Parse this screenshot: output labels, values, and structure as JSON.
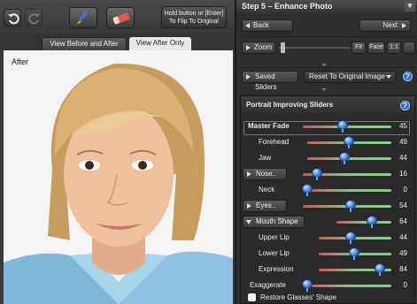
{
  "toolbar": {
    "undo_icon": "undo-icon",
    "redo_icon": "redo-icon",
    "brush_icon": "paintbrush-icon",
    "eraser_icon": "eraser-icon",
    "hint_line1": "Hold button or [Enter]",
    "hint_line2": "To Flip To Original"
  },
  "tabs": {
    "before_after": "View Before and After",
    "after_only": "View After Only"
  },
  "photo": {
    "label": "After"
  },
  "panel": {
    "title": "Step 5 – Enhance Photo",
    "back": "Back",
    "next": "Next",
    "zoom": "Zoom",
    "zoom_level": 0.02,
    "fit": "Fit",
    "face": "Face",
    "one_to_one": "1:1",
    "saved_sliders": "Saved Sliders",
    "preset_value": "Reset To Original Image",
    "help": "?"
  },
  "sliders": {
    "title": "Portrait Improving Sliders",
    "rows": [
      {
        "label": "Master Fade",
        "value": "45",
        "v": 45
      },
      {
        "label": "Forehead",
        "value": "49",
        "v": 49
      },
      {
        "label": "Jaw",
        "value": "44",
        "v": 44
      },
      {
        "label": "Nose..",
        "value": "16",
        "v": 16
      },
      {
        "label": "Neck",
        "value": "0",
        "v": 0
      },
      {
        "label": "Eyes..",
        "value": "54",
        "v": 54
      },
      {
        "label": "Mouth Shape",
        "value": "64",
        "v": 64
      },
      {
        "label": "Upper Lip",
        "value": "44",
        "v": 44
      },
      {
        "label": "Lower Lip",
        "value": "49",
        "v": 49
      },
      {
        "label": "Expression",
        "value": "84",
        "v": 84
      },
      {
        "label": "Exaggerate",
        "value": "0",
        "v": 0
      }
    ],
    "restore_glasses": "Restore Glasses' Shape"
  },
  "colors": {
    "accent_blue": "#3f7fd9",
    "panel_bg": "#2e2e2e"
  }
}
